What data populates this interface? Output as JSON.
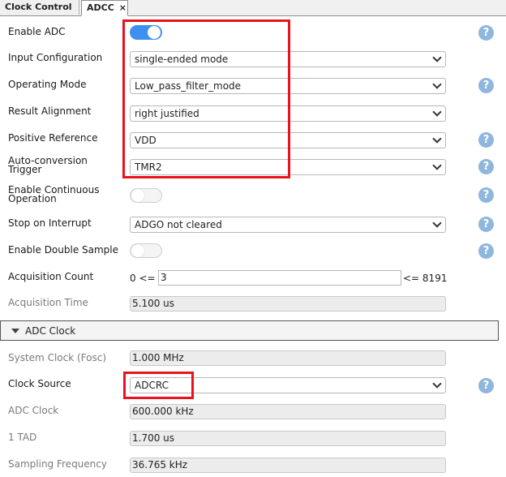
{
  "tabs": [
    {
      "label": "Clock Control"
    },
    {
      "label": "ADCC",
      "close": "×"
    }
  ],
  "help_glyph": "?",
  "fields": {
    "enable_adc": {
      "label": "Enable ADC",
      "state": "on"
    },
    "input_configuration": {
      "label": "Input Configuration",
      "value": "single-ended mode"
    },
    "operating_mode": {
      "label": "Operating Mode",
      "value": "Low_pass_filter_mode"
    },
    "result_alignment": {
      "label": "Result Alignment",
      "value": "right justified"
    },
    "positive_reference": {
      "label": "Positive Reference",
      "value": "VDD"
    },
    "auto_conversion_trigger": {
      "label_line1": "Auto-conversion",
      "label_line2": "Trigger",
      "value": "TMR2"
    },
    "enable_continuous_operation": {
      "label_line1": "Enable Continuous",
      "label_line2": "Operation",
      "state": "off"
    },
    "stop_on_interrupt": {
      "label": "Stop on Interrupt",
      "value": "ADGO not cleared"
    },
    "enable_double_sample": {
      "label": "Enable Double Sample",
      "state": "off"
    },
    "acquisition_count": {
      "label": "Acquisition Count",
      "min_text": "0 <=",
      "value": "3",
      "max_text": "<= 8191"
    },
    "acquisition_time": {
      "label": "Acquisition Time",
      "value": "5.100 us"
    }
  },
  "adc_clock_section": {
    "title": "ADC Clock",
    "system_clock": {
      "label": "System Clock (Fosc)",
      "value": "1.000 MHz"
    },
    "clock_source": {
      "label": "Clock Source",
      "value": "ADCRC"
    },
    "adc_clock": {
      "label": "ADC Clock",
      "value": "600.000 kHz"
    },
    "tad": {
      "label": "1 TAD",
      "value": "1.700 us"
    },
    "sampling_frequency": {
      "label": "Sampling Frequency",
      "value": "36.765 kHz"
    }
  },
  "colors": {
    "toggle_on": "#3d8ff0",
    "help_icon": "#8fb6dc",
    "highlight_box": "#e8131b"
  }
}
